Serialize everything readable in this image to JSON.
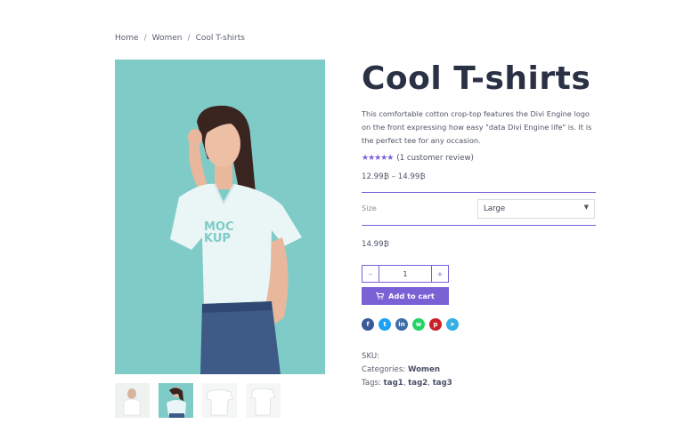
{
  "breadcrumb": {
    "home": "Home",
    "sep": "/",
    "category": "Women",
    "current": "Cool T-shirts"
  },
  "product": {
    "title": "Cool T-shirts",
    "description": "This comfortable cotton crop-top features the Divi Engine logo on the front expressing how easy \"data Divi Engine life\" is. It is the perfect tee for any occasion.",
    "rating_stars": "★★★★★",
    "review_text": "(1 customer review)",
    "price_range": "12.99₿ – 14.99₿",
    "price": "14.99₿",
    "mockup_text_line1": "MOC",
    "mockup_text_line2": "KUP"
  },
  "variation": {
    "label": "Size",
    "selected": "Large"
  },
  "quantity": {
    "minus": "–",
    "value": "1",
    "plus": "+"
  },
  "cart": {
    "label": "Add to cart"
  },
  "share_buttons": [
    {
      "name": "facebook",
      "glyph": "f",
      "color": "#3b5998"
    },
    {
      "name": "twitter",
      "glyph": "t",
      "color": "#1da1f2"
    },
    {
      "name": "linkedin",
      "glyph": "in",
      "color": "#3d6ca8"
    },
    {
      "name": "whatsapp",
      "glyph": "w",
      "color": "#25d366"
    },
    {
      "name": "pinterest",
      "glyph": "p",
      "color": "#cb2027"
    },
    {
      "name": "telegram",
      "glyph": "➤",
      "color": "#37aee2"
    }
  ],
  "meta": {
    "sku_label": "SKU:",
    "categories_label": "Categories:",
    "category": "Women",
    "tags_label": "Tags:",
    "tags": [
      "tag1",
      "tag2",
      "tag3"
    ]
  },
  "colors": {
    "accent": "#7b61d6",
    "title": "#2b3145",
    "image_bg": "#7fcbc7"
  }
}
